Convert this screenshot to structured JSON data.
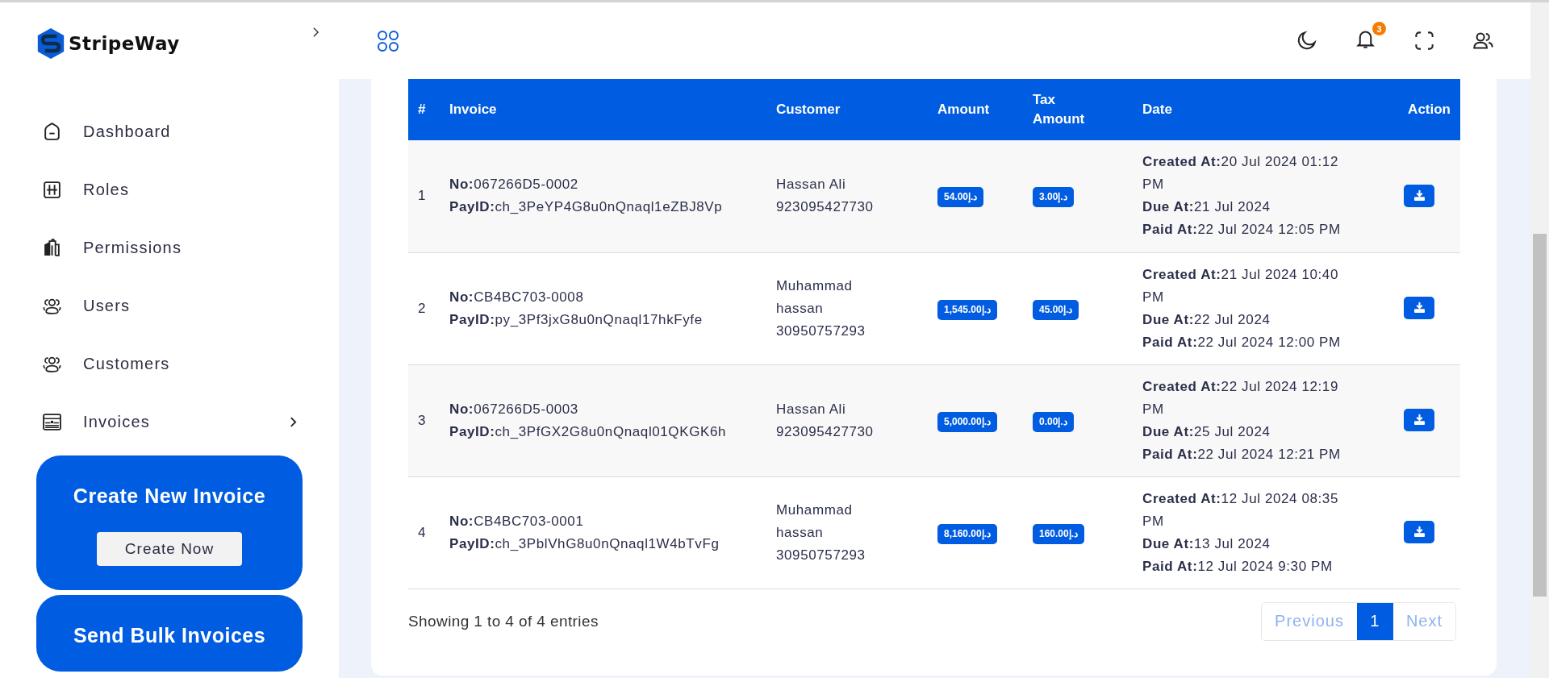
{
  "sidebar": {
    "logo": "StripeWay",
    "items": [
      {
        "label": "Dashboard",
        "kind": "home",
        "expandable": false
      },
      {
        "label": "Roles",
        "kind": "grid",
        "expandable": false
      },
      {
        "label": "Permissions",
        "kind": "building",
        "expandable": false
      },
      {
        "label": "Users",
        "kind": "users",
        "expandable": false
      },
      {
        "label": "Customers",
        "kind": "users",
        "expandable": false
      },
      {
        "label": "Invoices",
        "kind": "invoice",
        "expandable": true
      }
    ],
    "promo_cards": [
      {
        "title": "Create New Invoice",
        "button": "Create Now"
      },
      {
        "title": "Send Bulk Invoices"
      }
    ]
  },
  "header": {
    "notification_count": "3"
  },
  "table": {
    "columns": [
      "#",
      "Invoice",
      "Customer",
      "Amount",
      "Tax Amount",
      "Date",
      "Action"
    ],
    "rows": [
      {
        "index": "1",
        "invoice": [
          "**No:**067266D5-0002",
          "**PayID:**ch_3PeYP4G8u0nQnaql1eZBJ8Vp"
        ],
        "customer": {
          "name": "Hassan Ali",
          "phone": "923095427730"
        },
        "amount": "54.00د.إ",
        "tax_amount": "3.00د.إ",
        "dates": [
          "**Created At:**20 Jul 2024 01:12 PM",
          "**Due At:**21 Jul 2024",
          "**Paid At:**22 Jul 2024 12:05 PM"
        ]
      },
      {
        "index": "2",
        "invoice": [
          "**No:**CB4BC703-0008",
          "**PayID:**py_3Pf3jxG8u0nQnaql17hkFyfe"
        ],
        "customer": {
          "name": "Muhammad hassan",
          "phone": "30950757293"
        },
        "amount": "1,545.00د.إ",
        "tax_amount": "45.00د.إ",
        "dates": [
          "**Created At:**21 Jul 2024 10:40 PM",
          "**Due At:**22 Jul 2024",
          "**Paid At:**22 Jul 2024 12:00 PM"
        ]
      },
      {
        "index": "3",
        "invoice": [
          "**No:**067266D5-0003",
          "**PayID:**ch_3PfGX2G8u0nQnaql01QKGK6h"
        ],
        "customer": {
          "name": "Hassan Ali",
          "phone": "923095427730"
        },
        "amount": "5,000.00د.إ",
        "tax_amount": "0.00د.إ",
        "dates": [
          "**Created At:**22 Jul 2024 12:19 PM",
          "**Due At:**25 Jul 2024",
          "**Paid At:**22 Jul 2024 12:21 PM"
        ]
      },
      {
        "index": "4",
        "invoice": [
          "**No:**CB4BC703-0001",
          "**PayID:**ch_3PblVhG8u0nQnaql1W4bTvFg"
        ],
        "customer": {
          "name": "Muhammad hassan",
          "phone": "30950757293"
        },
        "amount": "8,160.00د.إ",
        "tax_amount": "160.00د.إ",
        "dates": [
          "**Created At:**12 Jul 2024 08:35 PM",
          "**Due At:**13 Jul 2024",
          "**Paid At:**12 Jul 2024 9:30 PM"
        ]
      }
    ]
  },
  "footer": {
    "summary": "Showing 1 to 4 of 4 entries",
    "pagination": {
      "previous": {
        "label": "Previous",
        "disabled": true
      },
      "pages": [
        {
          "label": "1",
          "selected": true
        }
      ],
      "next": {
        "label": "Next",
        "disabled": true
      }
    }
  }
}
